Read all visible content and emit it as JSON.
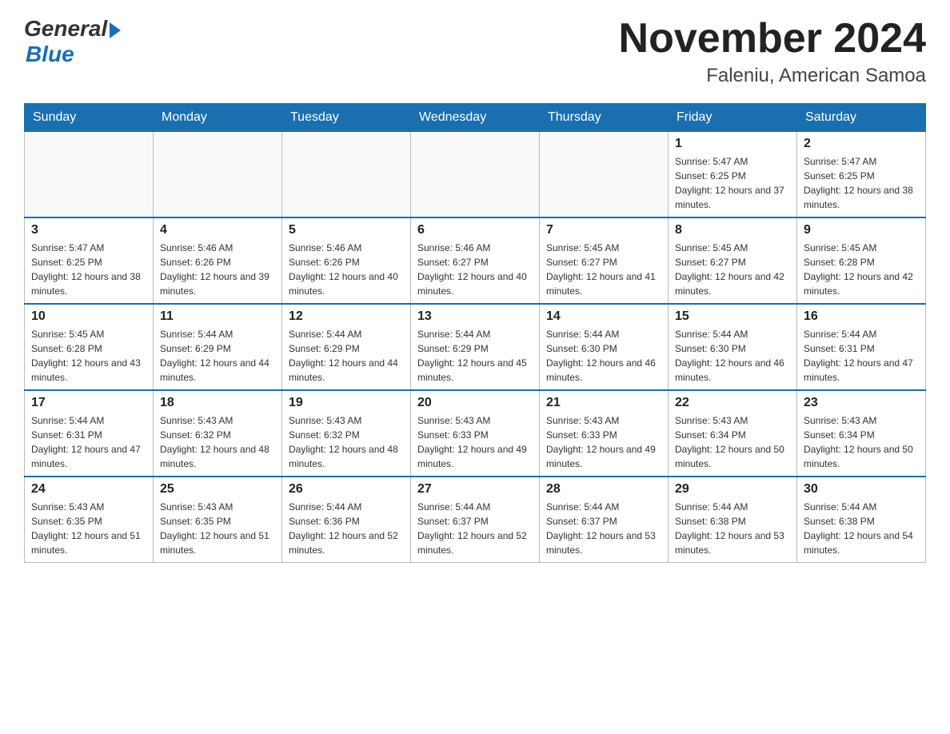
{
  "logo": {
    "general": "General",
    "blue": "Blue"
  },
  "title": {
    "month_year": "November 2024",
    "location": "Faleniu, American Samoa"
  },
  "weekdays": [
    "Sunday",
    "Monday",
    "Tuesday",
    "Wednesday",
    "Thursday",
    "Friday",
    "Saturday"
  ],
  "weeks": [
    [
      {
        "day": "",
        "sunrise": "",
        "sunset": "",
        "daylight": ""
      },
      {
        "day": "",
        "sunrise": "",
        "sunset": "",
        "daylight": ""
      },
      {
        "day": "",
        "sunrise": "",
        "sunset": "",
        "daylight": ""
      },
      {
        "day": "",
        "sunrise": "",
        "sunset": "",
        "daylight": ""
      },
      {
        "day": "",
        "sunrise": "",
        "sunset": "",
        "daylight": ""
      },
      {
        "day": "1",
        "sunrise": "Sunrise: 5:47 AM",
        "sunset": "Sunset: 6:25 PM",
        "daylight": "Daylight: 12 hours and 37 minutes."
      },
      {
        "day": "2",
        "sunrise": "Sunrise: 5:47 AM",
        "sunset": "Sunset: 6:25 PM",
        "daylight": "Daylight: 12 hours and 38 minutes."
      }
    ],
    [
      {
        "day": "3",
        "sunrise": "Sunrise: 5:47 AM",
        "sunset": "Sunset: 6:25 PM",
        "daylight": "Daylight: 12 hours and 38 minutes."
      },
      {
        "day": "4",
        "sunrise": "Sunrise: 5:46 AM",
        "sunset": "Sunset: 6:26 PM",
        "daylight": "Daylight: 12 hours and 39 minutes."
      },
      {
        "day": "5",
        "sunrise": "Sunrise: 5:46 AM",
        "sunset": "Sunset: 6:26 PM",
        "daylight": "Daylight: 12 hours and 40 minutes."
      },
      {
        "day": "6",
        "sunrise": "Sunrise: 5:46 AM",
        "sunset": "Sunset: 6:27 PM",
        "daylight": "Daylight: 12 hours and 40 minutes."
      },
      {
        "day": "7",
        "sunrise": "Sunrise: 5:45 AM",
        "sunset": "Sunset: 6:27 PM",
        "daylight": "Daylight: 12 hours and 41 minutes."
      },
      {
        "day": "8",
        "sunrise": "Sunrise: 5:45 AM",
        "sunset": "Sunset: 6:27 PM",
        "daylight": "Daylight: 12 hours and 42 minutes."
      },
      {
        "day": "9",
        "sunrise": "Sunrise: 5:45 AM",
        "sunset": "Sunset: 6:28 PM",
        "daylight": "Daylight: 12 hours and 42 minutes."
      }
    ],
    [
      {
        "day": "10",
        "sunrise": "Sunrise: 5:45 AM",
        "sunset": "Sunset: 6:28 PM",
        "daylight": "Daylight: 12 hours and 43 minutes."
      },
      {
        "day": "11",
        "sunrise": "Sunrise: 5:44 AM",
        "sunset": "Sunset: 6:29 PM",
        "daylight": "Daylight: 12 hours and 44 minutes."
      },
      {
        "day": "12",
        "sunrise": "Sunrise: 5:44 AM",
        "sunset": "Sunset: 6:29 PM",
        "daylight": "Daylight: 12 hours and 44 minutes."
      },
      {
        "day": "13",
        "sunrise": "Sunrise: 5:44 AM",
        "sunset": "Sunset: 6:29 PM",
        "daylight": "Daylight: 12 hours and 45 minutes."
      },
      {
        "day": "14",
        "sunrise": "Sunrise: 5:44 AM",
        "sunset": "Sunset: 6:30 PM",
        "daylight": "Daylight: 12 hours and 46 minutes."
      },
      {
        "day": "15",
        "sunrise": "Sunrise: 5:44 AM",
        "sunset": "Sunset: 6:30 PM",
        "daylight": "Daylight: 12 hours and 46 minutes."
      },
      {
        "day": "16",
        "sunrise": "Sunrise: 5:44 AM",
        "sunset": "Sunset: 6:31 PM",
        "daylight": "Daylight: 12 hours and 47 minutes."
      }
    ],
    [
      {
        "day": "17",
        "sunrise": "Sunrise: 5:44 AM",
        "sunset": "Sunset: 6:31 PM",
        "daylight": "Daylight: 12 hours and 47 minutes."
      },
      {
        "day": "18",
        "sunrise": "Sunrise: 5:43 AM",
        "sunset": "Sunset: 6:32 PM",
        "daylight": "Daylight: 12 hours and 48 minutes."
      },
      {
        "day": "19",
        "sunrise": "Sunrise: 5:43 AM",
        "sunset": "Sunset: 6:32 PM",
        "daylight": "Daylight: 12 hours and 48 minutes."
      },
      {
        "day": "20",
        "sunrise": "Sunrise: 5:43 AM",
        "sunset": "Sunset: 6:33 PM",
        "daylight": "Daylight: 12 hours and 49 minutes."
      },
      {
        "day": "21",
        "sunrise": "Sunrise: 5:43 AM",
        "sunset": "Sunset: 6:33 PM",
        "daylight": "Daylight: 12 hours and 49 minutes."
      },
      {
        "day": "22",
        "sunrise": "Sunrise: 5:43 AM",
        "sunset": "Sunset: 6:34 PM",
        "daylight": "Daylight: 12 hours and 50 minutes."
      },
      {
        "day": "23",
        "sunrise": "Sunrise: 5:43 AM",
        "sunset": "Sunset: 6:34 PM",
        "daylight": "Daylight: 12 hours and 50 minutes."
      }
    ],
    [
      {
        "day": "24",
        "sunrise": "Sunrise: 5:43 AM",
        "sunset": "Sunset: 6:35 PM",
        "daylight": "Daylight: 12 hours and 51 minutes."
      },
      {
        "day": "25",
        "sunrise": "Sunrise: 5:43 AM",
        "sunset": "Sunset: 6:35 PM",
        "daylight": "Daylight: 12 hours and 51 minutes."
      },
      {
        "day": "26",
        "sunrise": "Sunrise: 5:44 AM",
        "sunset": "Sunset: 6:36 PM",
        "daylight": "Daylight: 12 hours and 52 minutes."
      },
      {
        "day": "27",
        "sunrise": "Sunrise: 5:44 AM",
        "sunset": "Sunset: 6:37 PM",
        "daylight": "Daylight: 12 hours and 52 minutes."
      },
      {
        "day": "28",
        "sunrise": "Sunrise: 5:44 AM",
        "sunset": "Sunset: 6:37 PM",
        "daylight": "Daylight: 12 hours and 53 minutes."
      },
      {
        "day": "29",
        "sunrise": "Sunrise: 5:44 AM",
        "sunset": "Sunset: 6:38 PM",
        "daylight": "Daylight: 12 hours and 53 minutes."
      },
      {
        "day": "30",
        "sunrise": "Sunrise: 5:44 AM",
        "sunset": "Sunset: 6:38 PM",
        "daylight": "Daylight: 12 hours and 54 minutes."
      }
    ]
  ],
  "colors": {
    "header_bg": "#1a6faf",
    "header_text": "#ffffff",
    "border": "#bbbbbb",
    "day_number": "#222222",
    "info_text": "#333333"
  }
}
